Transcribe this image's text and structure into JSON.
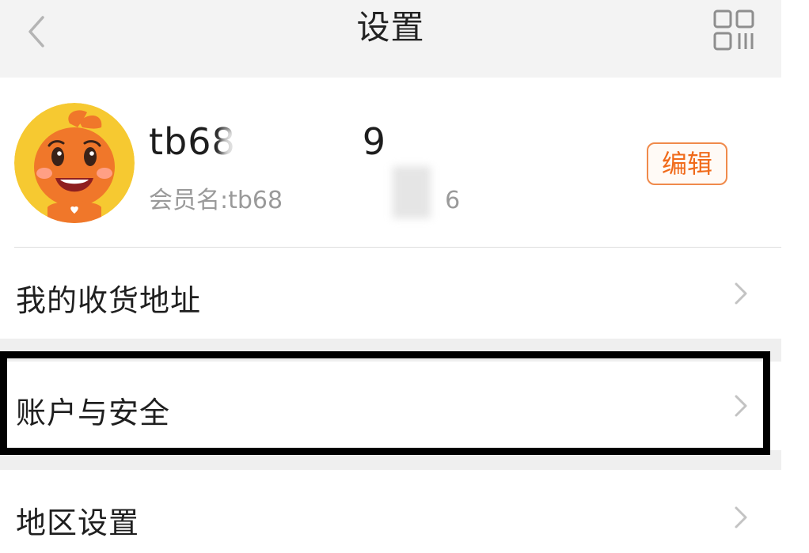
{
  "header": {
    "title": "设置",
    "back_icon": "chevron-left-icon",
    "qr_icon": "qr-code-icon"
  },
  "profile": {
    "avatar": "mascot-avatar",
    "nickname": "tb68",
    "nickname_tail": "9",
    "member_prefix": "会员名:tb68",
    "member_tail": "6",
    "edit_label": "编辑",
    "accent_color": "#f06a1a"
  },
  "menu": {
    "items": [
      {
        "label": "我的收货地址",
        "icon": "chevron-right-icon"
      },
      {
        "label": "账户与安全",
        "icon": "chevron-right-icon"
      },
      {
        "label": "地区设置",
        "icon": "chevron-right-icon"
      }
    ]
  }
}
